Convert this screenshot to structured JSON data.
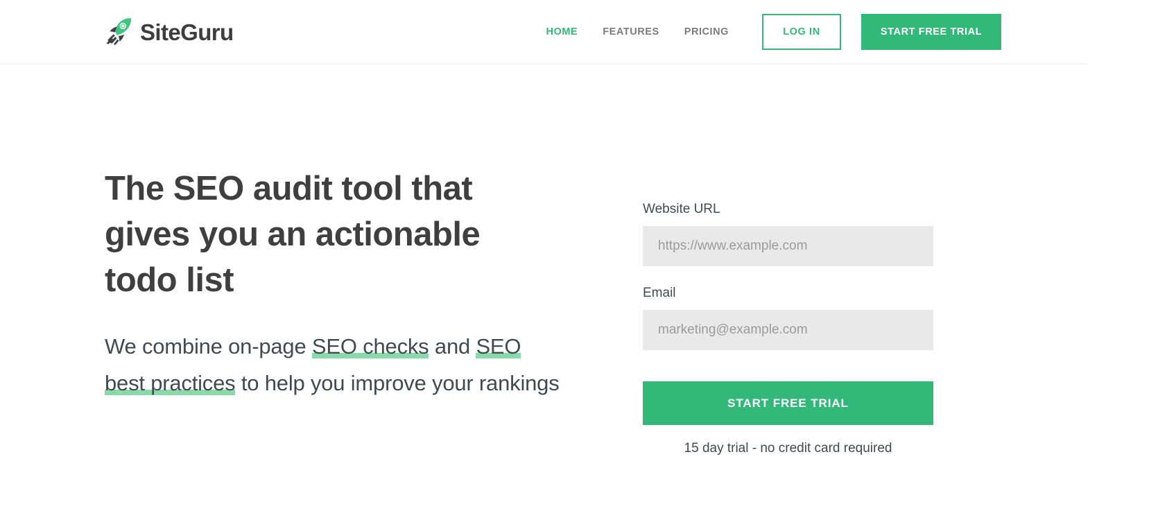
{
  "colors": {
    "brand_green": "#33b87a",
    "highlight_green": "#8ad9ab",
    "heading_gray": "#3f3f3f",
    "body_gray": "#3f4a52",
    "nav_gray": "#7c7c7c",
    "input_bg": "#e9e9e9",
    "placeholder_gray": "#9b9b9b"
  },
  "header": {
    "logo": {
      "icon": "rocket-icon",
      "text": "SiteGuru"
    },
    "nav_items": [
      {
        "label": "HOME",
        "active": true
      },
      {
        "label": "FEATURES",
        "active": false
      },
      {
        "label": "PRICING",
        "active": false
      }
    ],
    "login_label": "LOG IN",
    "trial_label": "START FREE TRIAL"
  },
  "hero": {
    "title": "The SEO audit tool that gives you an actionable todo list",
    "subtitle": {
      "part1": "We combine on-page ",
      "highlight1": "SEO checks",
      "part2": " and ",
      "highlight2": "SEO best practices",
      "part3": " to help you improve your rankings"
    },
    "form": {
      "url_label": "Website URL",
      "url_value": "",
      "url_placeholder": "https://www.example.com",
      "email_label": "Email",
      "email_value": "",
      "email_placeholder": "marketing@example.com",
      "submit_label": "START FREE TRIAL",
      "note": "15 day trial - no credit card required"
    }
  }
}
